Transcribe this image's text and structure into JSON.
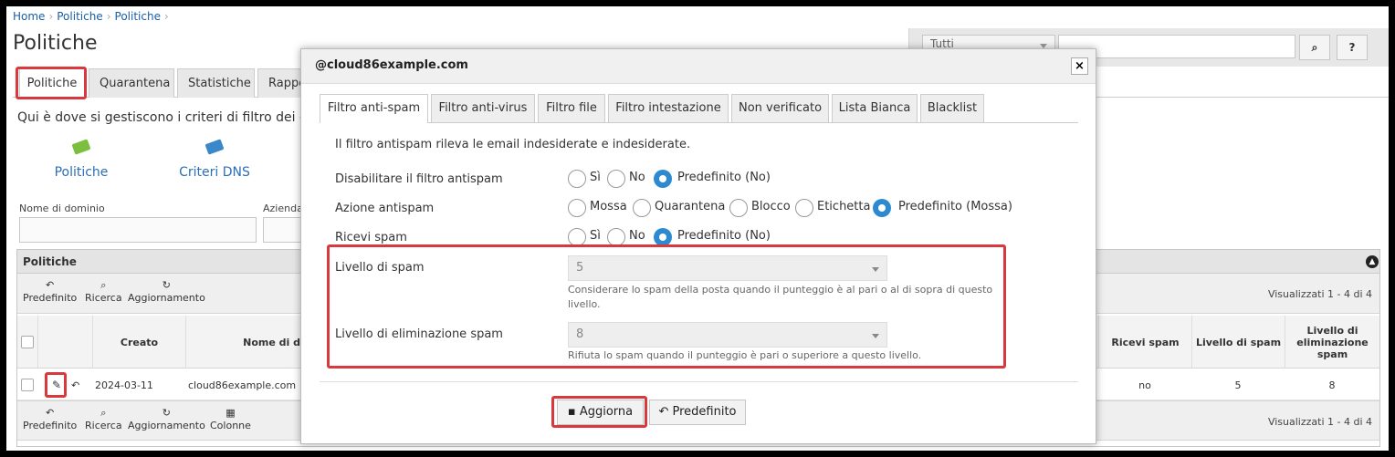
{
  "breadcrumb": [
    "Home",
    "Politiche",
    "Politiche"
  ],
  "page_title": "Politiche",
  "search": {
    "filter_value": "Tutti",
    "query": "",
    "search_icon": "search-icon",
    "help_label": "?"
  },
  "main_tabs": [
    {
      "label": "Politiche",
      "active": true
    },
    {
      "label": "Quarantena",
      "active": false
    },
    {
      "label": "Statistiche",
      "active": false
    },
    {
      "label": "Rappo",
      "active": false
    }
  ],
  "intro_text": "Qui è dove si gestiscono i criteri di filtro dei cont",
  "tiles": [
    {
      "label": "Politiche",
      "icon": "tag-icon",
      "color": "#7cbf3f"
    },
    {
      "label": "Criteri DNS",
      "icon": "tag-icon",
      "color": "#3a88c9"
    }
  ],
  "filters": {
    "domain_label": "Nome di dominio",
    "company_label": "Azienda"
  },
  "grid": {
    "title": "Politiche",
    "toolbar_top": [
      {
        "label": "Predefinito",
        "icon": "undo-icon"
      },
      {
        "label": "Ricerca",
        "icon": "search-icon"
      },
      {
        "label": "Aggiornamento",
        "icon": "refresh-icon"
      }
    ],
    "toolbar_bottom": [
      {
        "label": "Predefinito",
        "icon": "undo-icon"
      },
      {
        "label": "Ricerca",
        "icon": "search-icon"
      },
      {
        "label": "Aggiornamento",
        "icon": "refresh-icon"
      },
      {
        "label": "Colonne",
        "icon": "columns-icon"
      }
    ],
    "visualizzati": "Visualizzati 1 - 4 di 4",
    "columns": {
      "created": "Creato",
      "domain": "Nome di d",
      "receive_spam": "Ricevi spam",
      "spam_level": "Livello di spam",
      "delete_level": "Livello di eliminazione spam"
    },
    "row": {
      "created": "2024-03-11",
      "domain": "cloud86example.com",
      "receive_spam": "no",
      "spam_level": "5",
      "delete_level": "8"
    }
  },
  "modal": {
    "title": "@cloud86example.com",
    "close_label": "×",
    "tabs": [
      "Filtro anti-spam",
      "Filtro anti-virus",
      "Filtro file",
      "Filtro intestazione",
      "Non verificato",
      "Lista Bianca",
      "Blacklist"
    ],
    "active_tab": "Filtro anti-spam",
    "description": "Il filtro antispam rileva le email indesiderate e indesiderate.",
    "disable_filter": {
      "label": "Disabilitare il filtro antispam",
      "options": [
        "Sì",
        "No",
        "Predefinito (No)"
      ],
      "selected": "Predefinito (No)"
    },
    "spam_action": {
      "label": "Azione antispam",
      "options": [
        "Mossa",
        "Quarantena",
        "Blocco",
        "Etichetta",
        "Predefinito (Mossa)"
      ],
      "selected": "Predefinito (Mossa)"
    },
    "receive_spam": {
      "label": "Ricevi spam",
      "options": [
        "Sì",
        "No",
        "Predefinito (No)"
      ],
      "selected": "Predefinito (No)"
    },
    "spam_level": {
      "label": "Livello di spam",
      "value": "5",
      "hint": "Considerare lo spam della posta quando il punteggio è al pari o al di sopra di questo livello."
    },
    "delete_level": {
      "label": "Livello di eliminazione spam",
      "value": "8",
      "hint": "Rifiuta lo spam quando il punteggio è pari o superiore a questo livello."
    },
    "update_button": "Aggiorna",
    "default_button": "Predefinito"
  },
  "colors": {
    "accent": "#2d8ad0",
    "highlight": "#d9393c",
    "link": "#1a5ea8"
  }
}
